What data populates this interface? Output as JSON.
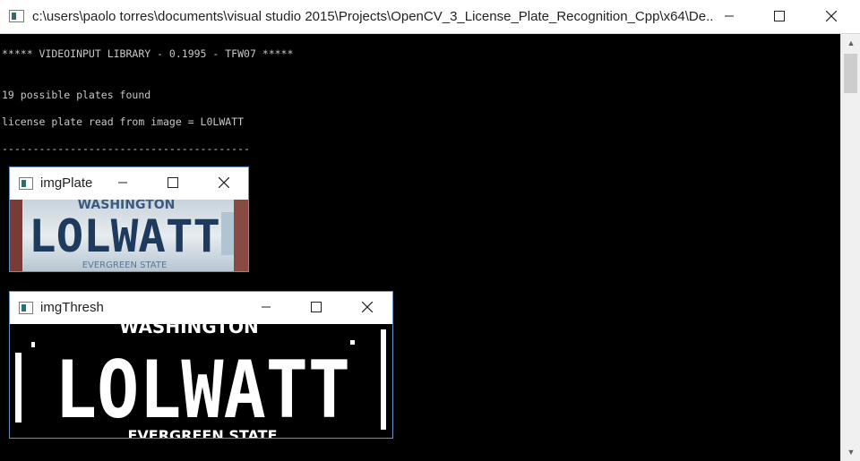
{
  "window": {
    "title": "c:\\users\\paolo torres\\documents\\visual studio 2015\\Projects\\OpenCV_3_License_Plate_Recognition_Cpp\\x64\\De...",
    "controls": [
      "minimize-icon",
      "maximize-icon",
      "close-icon"
    ]
  },
  "console": {
    "lines": [
      "***** VIDEOINPUT LIBRARY - 0.1995 - TFW07 *****",
      "19 possible plates found",
      "license plate read from image = L0LWATT",
      "----------------------------------------"
    ]
  },
  "plate_window": {
    "title": "imgPlate",
    "plate_top_text": "WASHINGTON",
    "plate_main_text": "LOLWATT",
    "plate_bottom_text": "EVERGREEN STATE"
  },
  "thresh_window": {
    "title": "imgThresh",
    "thresh_top_text": "WASHINGTON",
    "thresh_main_text": "LOLWATT",
    "thresh_bottom_text": "EVERGREEN STATE"
  },
  "colors": {
    "console_bg": "#000000",
    "console_text": "#c8c8c8",
    "window_border": "#6a8fc4",
    "plate_blue": "#1e3a5c"
  }
}
